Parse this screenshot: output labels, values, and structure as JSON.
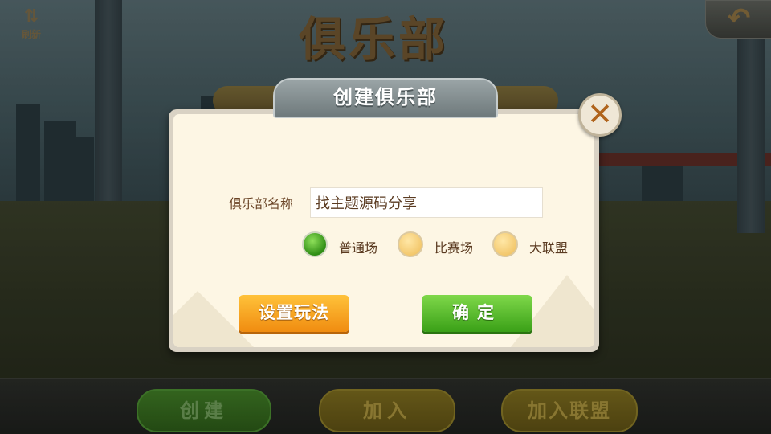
{
  "header": {
    "refresh_icon": "refresh-icon",
    "refresh_label": "刷新",
    "back_icon": "back-arrow-icon",
    "scene_title": "俱乐部"
  },
  "bottom_bar": {
    "create_label": "创建",
    "join_label": "加入",
    "join_alliance_label": "加入联盟"
  },
  "dialog": {
    "title": "创建俱乐部",
    "close_icon": "close-x-icon",
    "name_label": "俱乐部名称",
    "name_value": "找主题源码分享",
    "modes": [
      {
        "label": "普通场",
        "selected": true
      },
      {
        "label": "比赛场",
        "selected": false
      },
      {
        "label": "大联盟",
        "selected": false
      }
    ],
    "rules_button": "设置玩法",
    "confirm_button": "确定"
  },
  "colors": {
    "confirm_green": "#4fb624",
    "rules_orange": "#f7a724",
    "dialog_bg": "#fdf6e4",
    "label_brown": "#6a4426"
  }
}
